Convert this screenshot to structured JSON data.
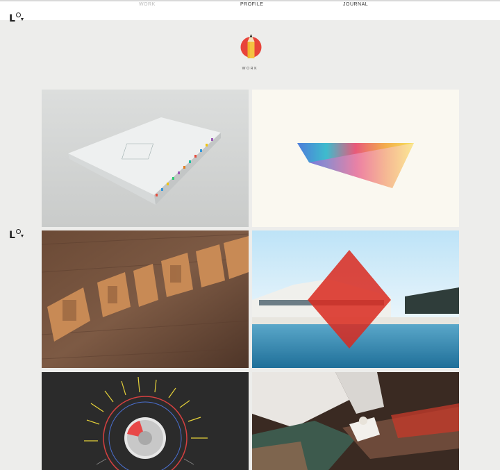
{
  "nav": {
    "links": [
      "WORK",
      "PROFILE",
      "JOURNAL"
    ]
  },
  "logo": {
    "text": "L"
  },
  "section": {
    "label": "WORK"
  },
  "colors": {
    "accent": "#e8443a",
    "pencil": "#f5c242",
    "page_bg": "#ededeb"
  },
  "gallery": {
    "items": [
      {
        "name": "white-book"
      },
      {
        "name": "rainbow-prism"
      },
      {
        "name": "wood-engraving"
      },
      {
        "name": "opera-house-triangle"
      },
      {
        "name": "radial-data-viz"
      },
      {
        "name": "tattoo-artist"
      }
    ]
  }
}
